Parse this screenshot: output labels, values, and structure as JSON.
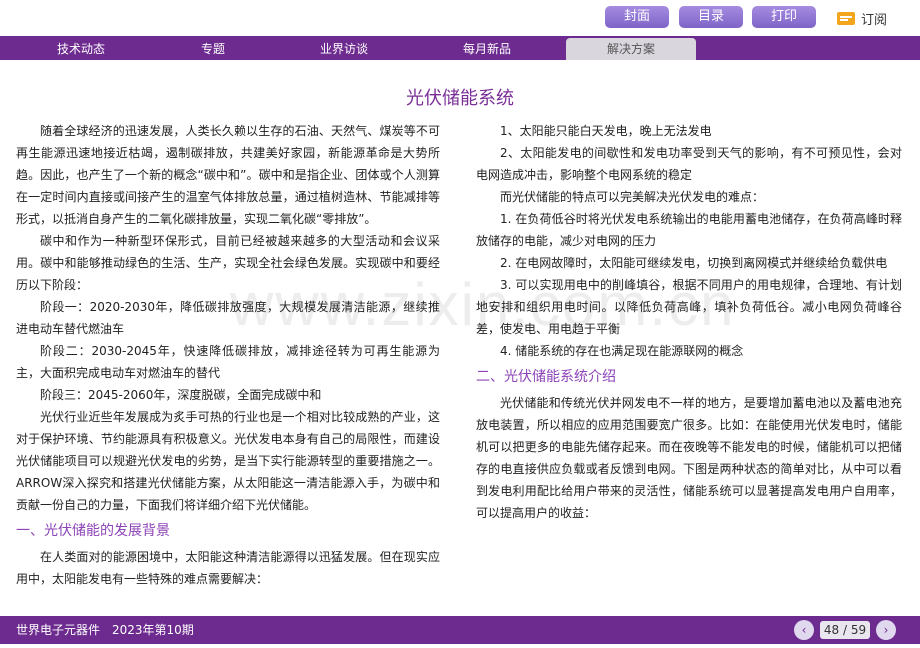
{
  "topbar": {
    "cover": "封面",
    "toc": "目录",
    "print": "打印",
    "subscribe": "订阅"
  },
  "nav": {
    "tabs": [
      "技术动态",
      "专题",
      "业界访谈",
      "每月新品",
      "解决方案"
    ],
    "active": "解决方案"
  },
  "article": {
    "title": "光伏储能系统",
    "left": [
      "随着全球经济的迅速发展，人类长久赖以生存的石油、天然气、煤炭等不可再生能源迅速地接近枯竭，遏制碳排放，共建美好家园，新能源革命是大势所趋。因此，也产生了一个新的概念“碳中和”。碳中和是指企业、团体或个人测算在一定时间内直接或间接产生的温室气体排放总量，通过植树造林、节能减排等形式，以抵消自身产生的二氧化碳排放量，实现二氧化碳“零排放”。",
      "碳中和作为一种新型环保形式，目前已经被越来越多的大型活动和会议采用。碳中和能够推动绿色的生活、生产，实现全社会绿色发展。实现碳中和要经历以下阶段：",
      "阶段一：2020-2030年，降低碳排放强度，大规模发展清洁能源，继续推进电动车替代燃油车",
      "阶段二：2030-2045年，快速降低碳排放，减排途径转为可再生能源为主，大面积完成电动车对燃油车的替代",
      "阶段三：2045-2060年，深度脱碳，全面完成碳中和",
      "光伏行业近些年发展成为炙手可热的行业也是一个相对比较成熟的产业，这对于保护环境、节约能源具有积极意义。光伏发电本身有自己的局限性，而建设光伏储能项目可以规避光伏发电的劣势，是当下实行能源转型的重要措施之一。ARROW深入探究和搭建光伏储能方案，从太阳能这一清洁能源入手，为碳中和贡献一份自己的力量，下面我们将详细介绍下光伏储能。"
    ],
    "h1": "一、光伏储能的发展背景",
    "left2": "在人类面对的能源困境中，太阳能这种清洁能源得以迅猛发展。但在现实应用中，太阳能发电有一些特殊的难点需要解决：",
    "right": [
      "1、太阳能只能白天发电，晚上无法发电",
      "2、太阳能发电的间歇性和发电功率受到天气的影响，有不可预见性，会对电网造成冲击，影响整个电网系统的稳定",
      "而光伏储能的特点可以完美解决光伏发电的难点：",
      "1. 在负荷低谷时将光伏发电系统输出的电能用蓄电池储存，在负荷高峰时释放储存的电能，减少对电网的压力",
      "2. 在电网故障时，太阳能可继续发电，切换到离网模式并继续给负载供电",
      "3. 可以实现用电中的削峰填谷，根据不同用户的用电规律，合理地、有计划地安排和组织用电时间。以降低负荷高峰，填补负荷低谷。减小电网负荷峰谷差，使发电、用电趋于平衡",
      "4. 储能系统的存在也满足现在能源联网的概念"
    ],
    "h2": "二、光伏储能系统介绍",
    "right2": "光伏储能和传统光伏并网发电不一样的地方，是要增加蓄电池以及蓄电池充放电装置，所以相应的应用范围要宽广很多。比如：在能使用光伏发电时，储能机可以把更多的电能先储存起来。而在夜晚等不能发电的时候，储能机可以把储存的电直接供应负载或者反馈到电网。下图是两种状态的简单对比，从中可以看到发电利用配比给用户带来的灵活性，储能系统可以显著提高发电用户自用率，可以提高用户的收益："
  },
  "watermark": "www.zixin.com.cn",
  "footer": {
    "publication": "世界电子元器件　2023年第10期",
    "page": "48 / 59",
    "prev": "‹",
    "next": "›"
  }
}
